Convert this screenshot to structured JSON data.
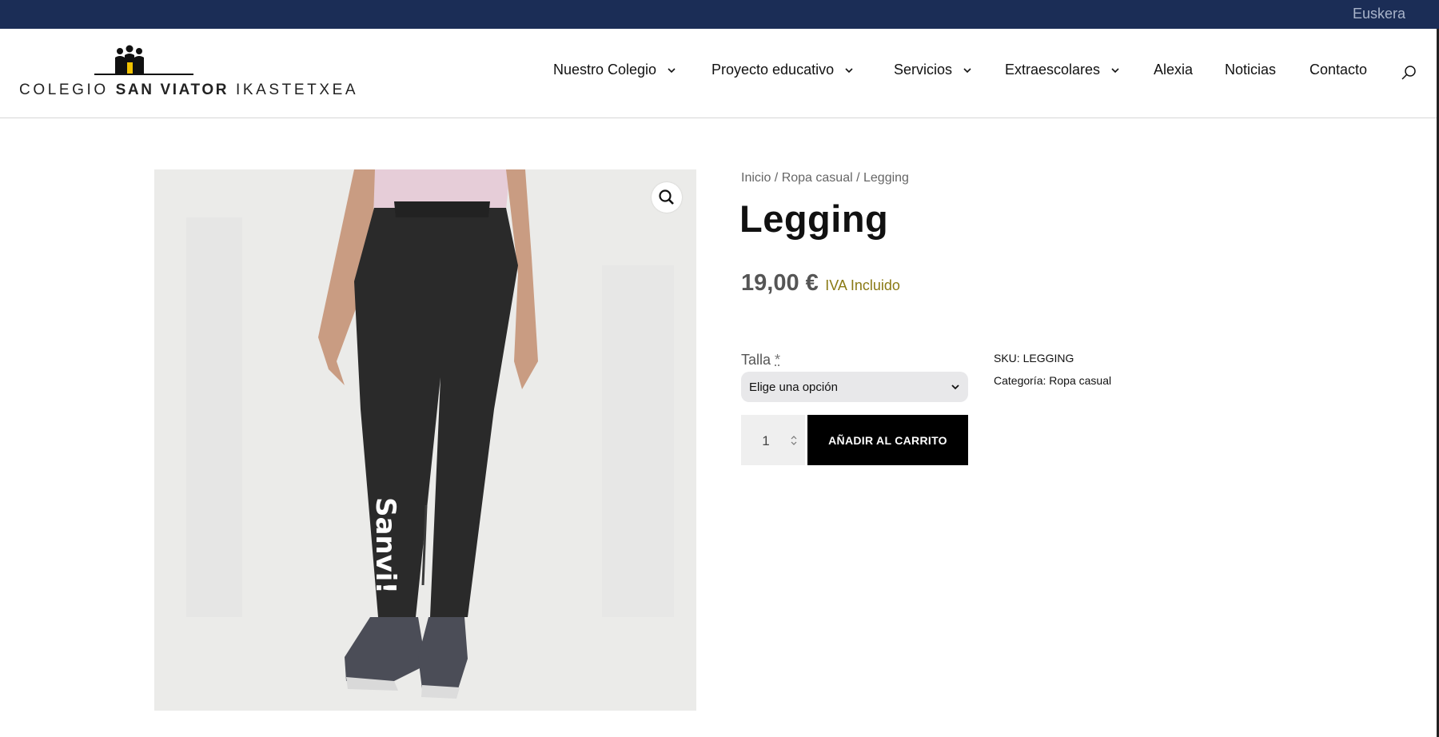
{
  "topbar": {
    "language_link": "Euskera"
  },
  "logo": {
    "text_left": "COLEGIO ",
    "text_bold": "SAN VIATOR",
    "text_right": " IKASTETXEA"
  },
  "nav": {
    "items": [
      {
        "label": "Nuestro Colegio",
        "has_submenu": true
      },
      {
        "label": "Proyecto educativo",
        "has_submenu": true
      },
      {
        "label": "Servicios",
        "has_submenu": true
      },
      {
        "label": "Extraescolares",
        "has_submenu": true
      },
      {
        "label": "Alexia",
        "has_submenu": false
      },
      {
        "label": "Noticias",
        "has_submenu": false
      },
      {
        "label": "Contacto",
        "has_submenu": false
      }
    ],
    "search_icon": "search-icon"
  },
  "breadcrumb": {
    "home": "Inicio",
    "sep1": " / ",
    "category": "Ropa casual",
    "sep2": " / ",
    "current": "Legging"
  },
  "product": {
    "title": "Legging",
    "price": "19,00 €",
    "tax_note": "IVA Incluido",
    "image_print": "Sanvi!",
    "variation": {
      "label": "Talla",
      "required_mark": "*",
      "selected": "Elige una opción"
    },
    "quantity": "1",
    "add_to_cart": "AÑADIR AL CARRITO",
    "sku_label": "SKU: ",
    "sku_value": "LEGGING",
    "category_label": "Categoría: ",
    "category_value": "Ropa casual"
  },
  "colors": {
    "topbar": "#1b2d56",
    "tax_note": "#8a7a15",
    "button": "#000000"
  }
}
